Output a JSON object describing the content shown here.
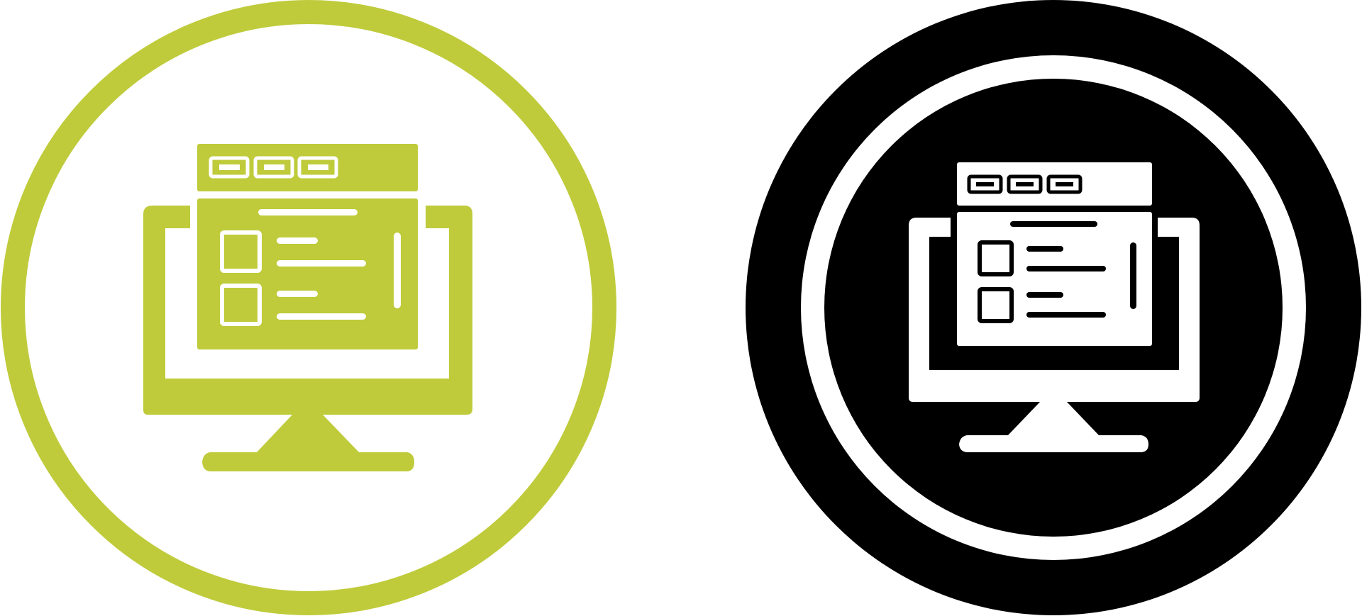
{
  "icons": [
    {
      "name": "web-app-monitor-icon",
      "style": "glyph",
      "accent_color": "#bfcb3a",
      "background_color": "#ffffff"
    },
    {
      "name": "web-app-monitor-icon",
      "style": "solid",
      "accent_color": "#000000",
      "background_color": "#ffffff"
    }
  ],
  "colors": {
    "lime": "#bfcb3a",
    "black": "#000000",
    "white": "#ffffff"
  }
}
